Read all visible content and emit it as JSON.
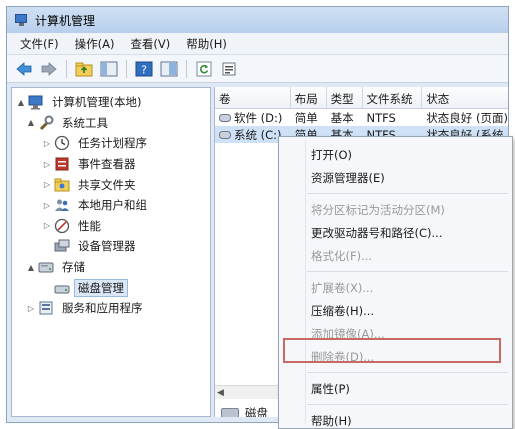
{
  "window": {
    "title": "计算机管理"
  },
  "menu": [
    "文件(F)",
    "操作(A)",
    "查看(V)",
    "帮助(H)"
  ],
  "toolbar": {
    "icons": [
      "back-arrow-icon",
      "forward-arrow-icon",
      "up-folder-icon",
      "console-tree-icon",
      "help-icon",
      "properties-icon",
      "refresh-icon",
      "export-icon"
    ]
  },
  "tree": [
    {
      "label": "计算机管理(本地)",
      "level": 0,
      "expander": "▲",
      "icon": "computer-management-icon"
    },
    {
      "label": "系统工具",
      "level": 1,
      "expander": "▲",
      "icon": "system-tools-icon"
    },
    {
      "label": "任务计划程序",
      "level": 2,
      "expander": "▷",
      "icon": "clock-icon"
    },
    {
      "label": "事件查看器",
      "level": 2,
      "expander": "▷",
      "icon": "event-viewer-icon"
    },
    {
      "label": "共享文件夹",
      "level": 2,
      "expander": "▷",
      "icon": "shared-folder-icon"
    },
    {
      "label": "本地用户和组",
      "level": 2,
      "expander": "▷",
      "icon": "users-icon"
    },
    {
      "label": "性能",
      "level": 2,
      "expander": "▷",
      "icon": "performance-icon"
    },
    {
      "label": "设备管理器",
      "level": 2,
      "expander": "",
      "icon": "device-manager-icon"
    },
    {
      "label": "存储",
      "level": 1,
      "expander": "▲",
      "icon": "storage-icon"
    },
    {
      "label": "磁盘管理",
      "level": 2,
      "expander": "",
      "icon": "disk-management-icon",
      "selected": true
    },
    {
      "label": "服务和应用程序",
      "level": 1,
      "expander": "▷",
      "icon": "services-icon"
    }
  ],
  "list": {
    "columns": [
      "卷",
      "布局",
      "类型",
      "文件系统",
      "状态"
    ],
    "rows": [
      [
        "软件 (D:)",
        "简单",
        "基本",
        "NTFS",
        "状态良好 (页面)"
      ],
      [
        "系统 (C:)",
        "简单",
        "基本",
        "NTFS",
        "状态良好 (系统"
      ]
    ],
    "disk_label": "磁盘"
  },
  "context_menu": [
    {
      "label": "打开(O)",
      "enabled": true
    },
    {
      "label": "资源管理器(E)",
      "enabled": true
    },
    {
      "sep": true
    },
    {
      "label": "将分区标记为活动分区(M)",
      "enabled": false
    },
    {
      "label": "更改驱动器号和路径(C)...",
      "enabled": true
    },
    {
      "label": "格式化(F)...",
      "enabled": false
    },
    {
      "sep": true
    },
    {
      "label": "扩展卷(X)...",
      "enabled": false
    },
    {
      "label": "压缩卷(H)...",
      "enabled": true
    },
    {
      "label": "添加镜像(A)...",
      "enabled": false
    },
    {
      "label": "删除卷(D)...",
      "enabled": false
    },
    {
      "sep": true
    },
    {
      "label": "属性(P)",
      "enabled": true
    },
    {
      "sep": true
    },
    {
      "label": "帮助(H)",
      "enabled": true
    }
  ],
  "colors": {
    "highlight_box": "#c86a63",
    "selection": "#cfe1f7"
  }
}
